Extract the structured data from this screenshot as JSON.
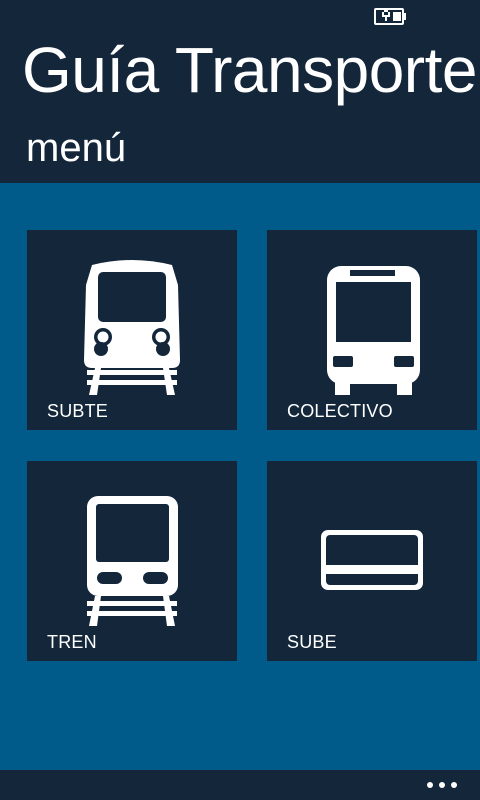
{
  "header": {
    "app_title": "Guía Transporte Bs As",
    "page_title": "menú"
  },
  "status_bar": {
    "icons": [
      "battery-charging-icon"
    ]
  },
  "tiles": [
    {
      "label": "SUBTE",
      "icon": "subway-train-icon"
    },
    {
      "label": "COLECTIVO",
      "icon": "bus-icon"
    },
    {
      "label": "TREN",
      "icon": "train-icon"
    },
    {
      "label": "SUBE",
      "icon": "card-icon"
    }
  ],
  "app_bar": {
    "more_icon": "more-ellipsis-icon"
  },
  "colors": {
    "accent": "#005a8a",
    "tile_background": "#13263a",
    "text": "#ffffff"
  }
}
